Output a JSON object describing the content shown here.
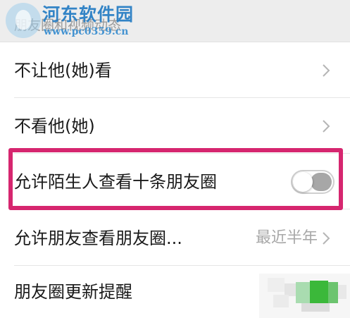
{
  "section": {
    "title": "朋友圈和视频动态"
  },
  "watermark": {
    "name": "河东软件园",
    "url": "www.pc0359.cn"
  },
  "settings": [
    {
      "label": "不让他(她)看"
    },
    {
      "label": "不看他(她)"
    },
    {
      "label": "允许陌生人查看十条朋友圈",
      "toggle_state": "off"
    },
    {
      "label": "允许朋友查看朋友圈...",
      "value": "最近半年"
    },
    {
      "label": "朋友圈更新提醒"
    }
  ],
  "colors": {
    "highlight": "#d6266f",
    "toggle_off": "#a7a7a7",
    "toggle_on": "#1aad19",
    "section_bg": "#ededed"
  }
}
